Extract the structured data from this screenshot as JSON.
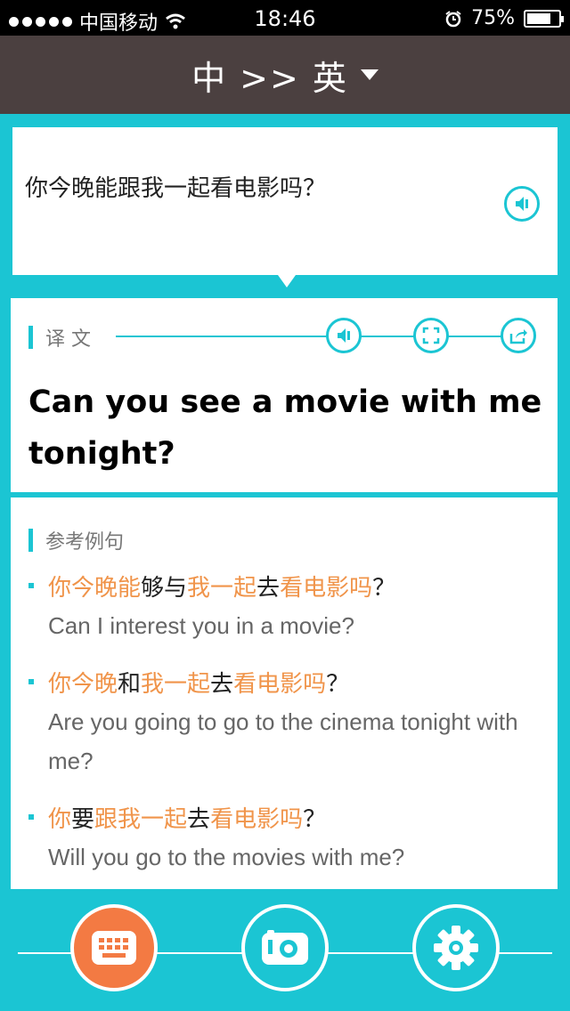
{
  "status_bar": {
    "carrier": "中国移动",
    "time": "18:46",
    "battery_percent": "75%",
    "battery_level": 0.75
  },
  "nav": {
    "title": "中 >> 英"
  },
  "source": {
    "text": "你今晚能跟我一起看电影吗？"
  },
  "result": {
    "label": "译 文",
    "text": "Can you see a movie with me tonight?"
  },
  "examples": {
    "label": "参考例句",
    "items": [
      {
        "zh": [
          {
            "t": "你今晚能",
            "hl": true
          },
          {
            "t": "够与",
            "hl": false
          },
          {
            "t": "我一起",
            "hl": true
          },
          {
            "t": "去",
            "hl": false
          },
          {
            "t": "看电影吗",
            "hl": true
          },
          {
            "t": "？",
            "hl": false
          }
        ],
        "en": "Can I interest you in a movie?"
      },
      {
        "zh": [
          {
            "t": "你今晚",
            "hl": true
          },
          {
            "t": "和",
            "hl": false
          },
          {
            "t": "我一起",
            "hl": true
          },
          {
            "t": "去",
            "hl": false
          },
          {
            "t": "看电影吗",
            "hl": true
          },
          {
            "t": "？",
            "hl": false
          }
        ],
        "en": "Are you going to go to the cinema tonight with me?"
      },
      {
        "zh": [
          {
            "t": "你",
            "hl": true
          },
          {
            "t": "要",
            "hl": false
          },
          {
            "t": "跟我一起",
            "hl": true
          },
          {
            "t": "去",
            "hl": false
          },
          {
            "t": "看电影吗",
            "hl": true
          },
          {
            "t": "？",
            "hl": false
          }
        ],
        "en": "Will you go to the movies with me?"
      }
    ]
  },
  "bottom": {
    "buttons": [
      "keyboard-icon",
      "camera-icon",
      "settings-gear-icon"
    ]
  },
  "colors": {
    "accent": "#1bc5d3",
    "highlight": "#f0944a",
    "nav_bg": "#4b4040",
    "keyboard_button": "#f37a43"
  }
}
